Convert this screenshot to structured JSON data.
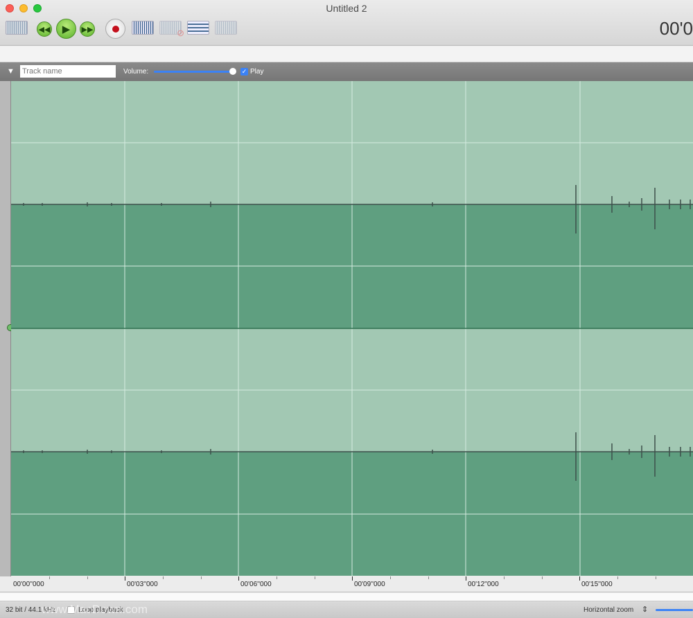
{
  "window": {
    "title": "Untitled 2",
    "time_display": "00'0"
  },
  "toolbar": {
    "buttons": [
      "waveform-overview-icon",
      "rewind-icon",
      "play-icon",
      "fast-forward-icon",
      "record-icon",
      "waveform-icon",
      "delete-waveform-icon",
      "mix-icon",
      "split-icon"
    ]
  },
  "track": {
    "name_value": "",
    "name_placeholder": "Track name",
    "volume_label": "Volume:",
    "volume": 1.0,
    "play_label": "Play",
    "play_checked": true
  },
  "colors": {
    "wave_light": "#a2c8b3",
    "wave_dark": "#5f9f80",
    "grid": "#d6ebe0",
    "accent": "#3b82f6"
  },
  "ruler": {
    "labels": [
      "00'00''000",
      "00'03''000",
      "00'06''000",
      "00'09''000",
      "00'12''000",
      "00'15''000"
    ]
  },
  "status": {
    "format": "32 bit / 44.1 kHz",
    "loop_label": "Loop playback",
    "loop_checked": false,
    "zoom_label": "Horizontal zoom"
  },
  "watermark": "www.MacDown.com"
}
